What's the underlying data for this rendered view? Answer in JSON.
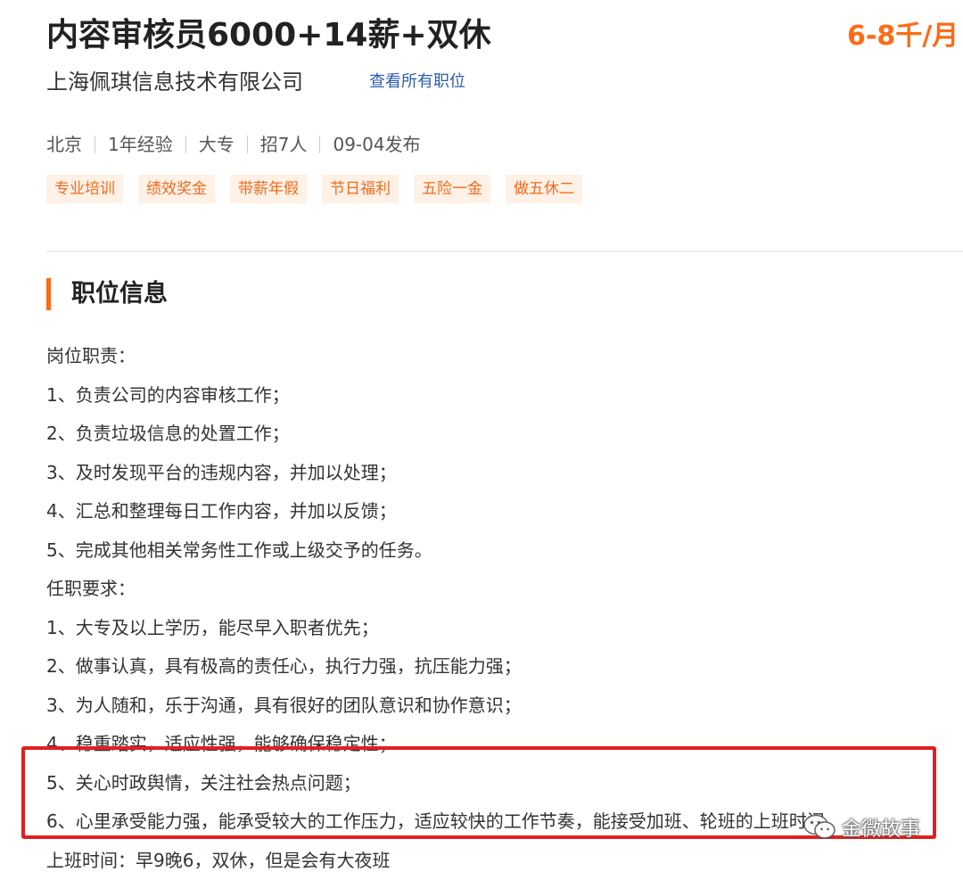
{
  "job": {
    "title": "内容审核员6000+14薪+双休",
    "salary": "6-8千/月",
    "company": "上海佩琪信息技术有限公司",
    "all_jobs_link": "查看所有职位"
  },
  "meta": [
    "北京",
    "1年经验",
    "大专",
    "招7人",
    "09-04发布"
  ],
  "tags": [
    "专业培训",
    "绩效奖金",
    "带薪年假",
    "节日福利",
    "五险一金",
    "做五休二"
  ],
  "section": {
    "title": "职位信息"
  },
  "description": [
    "岗位职责：",
    "1、负责公司的内容审核工作；",
    "2、负责垃圾信息的处置工作；",
    "3、及时发现平台的违规内容，并加以处理；",
    "4、汇总和整理每日工作内容，并加以反馈；",
    "5、完成其他相关常务性工作或上级交予的任务。",
    "任职要求：",
    "1、大专及以上学历，能尽早入职者优先；",
    "2、做事认真，具有极高的责任心，执行力强，抗压能力强；",
    "3、为人随和，乐于沟通，具有很好的团队意识和协作意识；",
    "4、稳重踏实，适应性强，能够确保稳定性；",
    "5、关心时政舆情，关注社会热点问题；",
    "6、心里承受能力强，能承受较大的工作压力，适应较快的工作节奏，能接受加班、轮班的上班时间。",
    "上班时间：早9晚6，双休，但是会有大夜班"
  ],
  "watermark": {
    "text": "金微故事",
    "icon": "wechat-icon"
  },
  "colors": {
    "accent": "#ff6a13",
    "link": "#2a5db0",
    "tag_bg": "#fff1e6",
    "tag_text": "#f26b1d",
    "highlight": "#e02020"
  }
}
